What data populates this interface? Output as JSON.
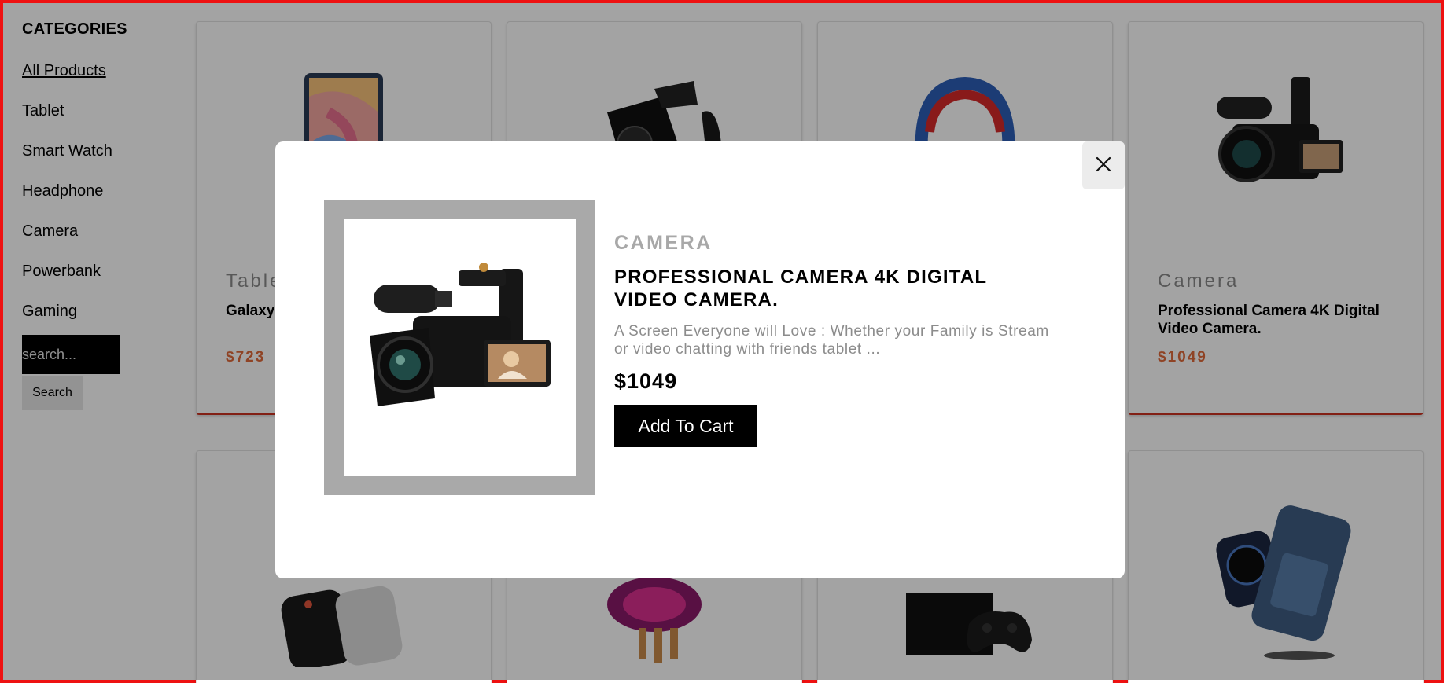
{
  "sidebar": {
    "title": "CATEGORIES",
    "items": [
      {
        "label": "All Products",
        "active": true
      },
      {
        "label": "Tablet"
      },
      {
        "label": "Smart Watch"
      },
      {
        "label": "Headphone"
      },
      {
        "label": "Camera"
      },
      {
        "label": "Powerbank"
      },
      {
        "label": "Gaming"
      }
    ],
    "search_placeholder": "search...",
    "search_button": "Search"
  },
  "products": [
    {
      "category": "Table",
      "name": "Galaxy Androi",
      "price": "$723",
      "icon": "tablet-image"
    },
    {
      "category": "",
      "name": "",
      "price": "",
      "icon": "smartwatch-image"
    },
    {
      "category": "",
      "name": "",
      "price": "",
      "icon": "headphone-image"
    },
    {
      "category": "Camera",
      "name": "Professional Camera 4K Digital Video Camera.",
      "price": "$1049",
      "icon": "camera-image"
    },
    {
      "icon": "powerbank-image"
    },
    {
      "icon": "gaming-rgb-image"
    },
    {
      "icon": "game-console-image"
    },
    {
      "icon": "wireless-powerbank-image"
    }
  ],
  "modal": {
    "category": "CAMERA",
    "title": "PROFESSIONAL CAMERA 4K DIGITAL VIDEO CAMERA.",
    "description": "A Screen Everyone will Love : Whether your Family is Stream or video chatting with friends tablet ...",
    "price": "$1049",
    "add_to_cart": "Add To Cart",
    "close_icon": "close-icon"
  },
  "colors": {
    "page_border": "#ee1111",
    "price_accent": "#e06a3a",
    "overlay": "rgba(0,0,0,0.36)",
    "button_bg": "#000000"
  }
}
